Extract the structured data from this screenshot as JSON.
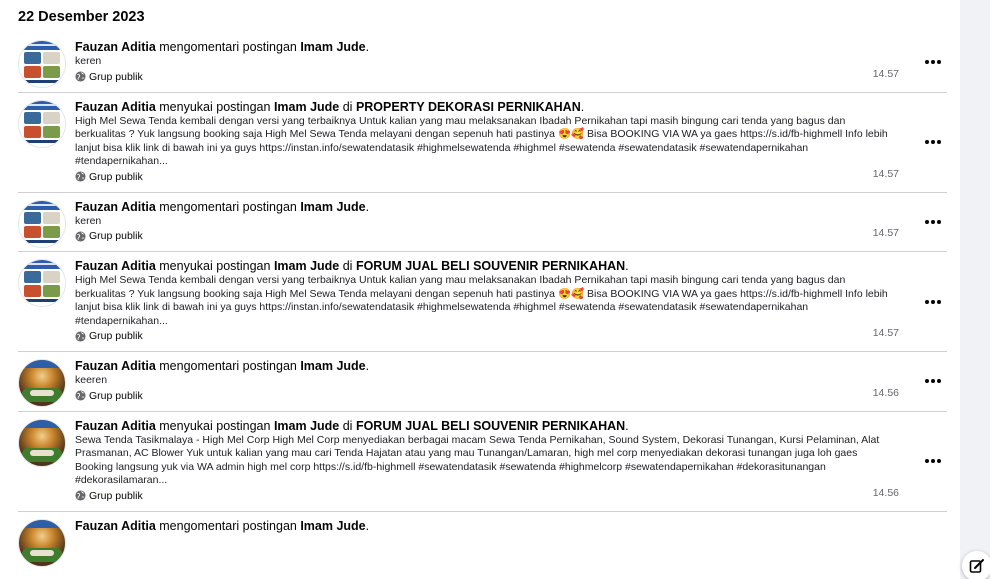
{
  "date_heading": "22 Desember 2023",
  "items": [
    {
      "avatar": "tenda",
      "actor": "Fauzan Aditia",
      "action": " mengomentari postingan ",
      "target": "Imam Jude",
      "in_word": "",
      "group": "",
      "end": ".",
      "text": "keren",
      "audience": "Grup publik",
      "time": "14.57"
    },
    {
      "avatar": "tenda",
      "actor": "Fauzan Aditia",
      "action": " menyukai postingan ",
      "target": "Imam Jude",
      "in_word": " di ",
      "group": "PROPERTY DEKORASI PERNIKAHAN",
      "end": ".",
      "text": "High Mel Sewa Tenda kembali dengan versi yang terbaiknya Untuk kalian yang mau melaksanakan Ibadah Pernikahan tapi masih bingung cari tenda yang bagus dan berkualitas ? Yuk langsung booking saja High Mel Sewa Tenda melayani dengan sepenuh hati pastinya 😍🥰 Bisa BOOKING VIA WA ya gaes https://s.id/fb-highmell Info lebih lanjut bisa klik link di bawah ini ya guys https://instan.info/sewatendatasik #highmelsewatenda #highmel #sewatenda #sewatendatasik #sewatendapernikahan #tendapernikahan...",
      "audience": "Grup publik",
      "time": "14.57"
    },
    {
      "avatar": "tenda",
      "actor": "Fauzan Aditia",
      "action": " mengomentari postingan ",
      "target": "Imam Jude",
      "in_word": "",
      "group": "",
      "end": ".",
      "text": "keren",
      "audience": "Grup publik",
      "time": "14.57"
    },
    {
      "avatar": "tenda",
      "actor": "Fauzan Aditia",
      "action": " menyukai postingan ",
      "target": "Imam Jude",
      "in_word": " di ",
      "group": "FORUM JUAL BELI SOUVENIR PERNIKAHAN",
      "end": ".",
      "text": "High Mel Sewa Tenda kembali dengan versi yang terbaiknya Untuk kalian yang mau melaksanakan Ibadah Pernikahan tapi masih bingung cari tenda yang bagus dan berkualitas ? Yuk langsung booking saja High Mel Sewa Tenda melayani dengan sepenuh hati pastinya 😍🥰 Bisa BOOKING VIA WA ya gaes https://s.id/fb-highmell Info lebih lanjut bisa klik link di bawah ini ya guys https://instan.info/sewatendatasik #highmelsewatenda #highmel #sewatenda #sewatendatasik #sewatendapernikahan #tendapernikahan...",
      "audience": "Grup publik",
      "time": "14.57"
    },
    {
      "avatar": "decor",
      "actor": "Fauzan Aditia",
      "action": " mengomentari postingan ",
      "target": "Imam Jude",
      "in_word": "",
      "group": "",
      "end": ".",
      "text": "keeren",
      "audience": "Grup publik",
      "time": "14.56"
    },
    {
      "avatar": "decor",
      "actor": "Fauzan Aditia",
      "action": " menyukai postingan ",
      "target": "Imam Jude",
      "in_word": " di ",
      "group": "FORUM JUAL BELI SOUVENIR PERNIKAHAN",
      "end": ".",
      "text": "Sewa Tenda Tasikmalaya - High Mel Corp High Mel Corp menyediakan berbagai macam Sewa Tenda Pernikahan, Sound System, Dekorasi Tunangan, Kursi Pelaminan, Alat Prasmanan, AC Blower Yuk untuk kalian yang mau cari Tenda Hajatan atau yang mau Tunangan/Lamaran, high mel corp menyediakan dekorasi tunangan juga loh gaes Booking langsung yuk via WA admin high mel corp https://s.id/fb-highmell #sewatendatasik #sewatenda #highmelcorp #sewatendapernikahan #dekorasitunangan #dekorasilamaran...",
      "audience": "Grup publik",
      "time": "14.56"
    },
    {
      "avatar": "decor",
      "actor": "Fauzan Aditia",
      "action": " mengomentari postingan ",
      "target": "Imam Jude",
      "in_word": "",
      "group": "",
      "end": ".",
      "text": "",
      "audience": "",
      "time": ""
    }
  ],
  "icons": {
    "globe": "globe-icon",
    "more": "more-options-icon",
    "compose": "compose-edit-icon"
  }
}
